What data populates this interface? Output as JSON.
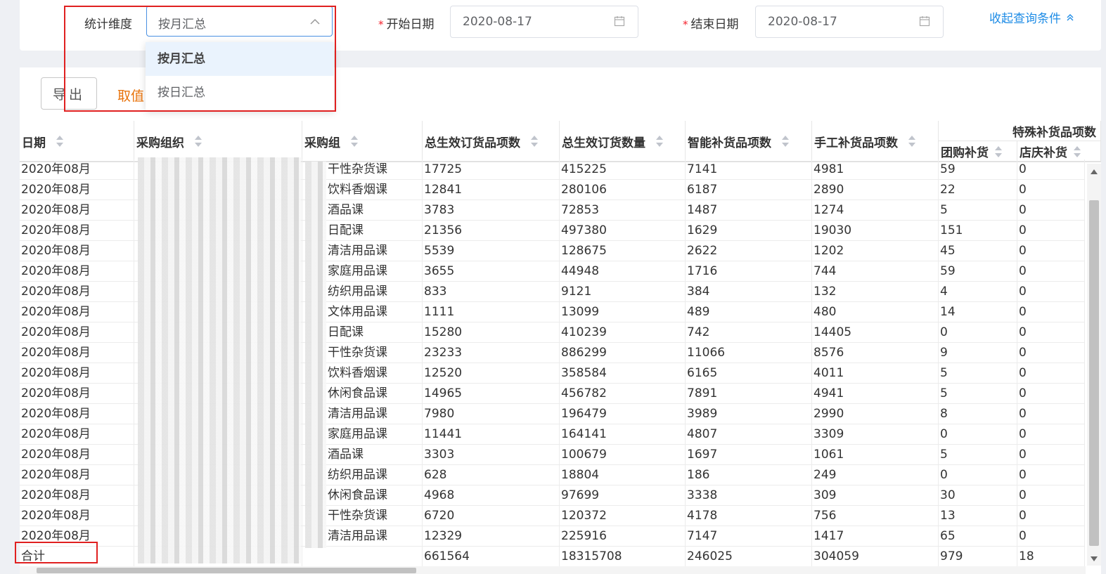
{
  "query": {
    "dimension_label": "统计维度",
    "dimension_value": "按月汇总",
    "start_label": "开始日期",
    "start_value": "2020-08-17",
    "end_label": "结束日期",
    "end_value": "2020-08-17",
    "required_mark": "*",
    "collapse_label": "收起查询条件"
  },
  "dropdown": {
    "options": [
      "按月汇总",
      "按日汇总"
    ],
    "selected": "按月汇总"
  },
  "toolbar": {
    "export_label": "导出",
    "value_link": "取值"
  },
  "table": {
    "headers": {
      "date": "日期",
      "org": "采购组织",
      "group": "采购组",
      "total_items": "总生效订货品项数",
      "total_qty": "总生效订货数量",
      "smart_items": "智能补货品项数",
      "manual_items": "手工补货品项数",
      "special": "特殊补货品项数",
      "group_buy": "团购补货",
      "store_event": "店庆补货"
    },
    "rows": [
      {
        "date": "2020年08月",
        "org": "",
        "group": "干性杂货课",
        "total_items": "17725",
        "total_qty": "415225",
        "smart_items": "7141",
        "manual_items": "4981",
        "group_buy": "59",
        "store_event": "0"
      },
      {
        "date": "2020年08月",
        "org": "",
        "group": "饮料香烟课",
        "total_items": "12841",
        "total_qty": "280106",
        "smart_items": "6187",
        "manual_items": "2890",
        "group_buy": "22",
        "store_event": "0"
      },
      {
        "date": "2020年08月",
        "org": "",
        "group": "酒品课",
        "total_items": "3783",
        "total_qty": "72853",
        "smart_items": "1487",
        "manual_items": "1274",
        "group_buy": "5",
        "store_event": "0"
      },
      {
        "date": "2020年08月",
        "org": "",
        "group": "日配课",
        "total_items": "21356",
        "total_qty": "497380",
        "smart_items": "1629",
        "manual_items": "19030",
        "group_buy": "151",
        "store_event": "0"
      },
      {
        "date": "2020年08月",
        "org": "",
        "group": "清洁用品课",
        "total_items": "5539",
        "total_qty": "128675",
        "smart_items": "2622",
        "manual_items": "1202",
        "group_buy": "45",
        "store_event": "0"
      },
      {
        "date": "2020年08月",
        "org": "",
        "group": "家庭用品课",
        "total_items": "3655",
        "total_qty": "44948",
        "smart_items": "1716",
        "manual_items": "744",
        "group_buy": "59",
        "store_event": "0"
      },
      {
        "date": "2020年08月",
        "org": "",
        "group": "纺织用品课",
        "total_items": "833",
        "total_qty": "9121",
        "smart_items": "384",
        "manual_items": "132",
        "group_buy": "4",
        "store_event": "0"
      },
      {
        "date": "2020年08月",
        "org": "",
        "group": "文体用品课",
        "total_items": "1111",
        "total_qty": "13099",
        "smart_items": "489",
        "manual_items": "480",
        "group_buy": "14",
        "store_event": "0"
      },
      {
        "date": "2020年08月",
        "org": "",
        "group": "日配课",
        "total_items": "15280",
        "total_qty": "410239",
        "smart_items": "742",
        "manual_items": "14405",
        "group_buy": "0",
        "store_event": "0"
      },
      {
        "date": "2020年08月",
        "org": "",
        "group": "干性杂货课",
        "total_items": "23233",
        "total_qty": "886299",
        "smart_items": "11066",
        "manual_items": "8576",
        "group_buy": "9",
        "store_event": "0"
      },
      {
        "date": "2020年08月",
        "org": "",
        "group": "饮料香烟课",
        "total_items": "12520",
        "total_qty": "358584",
        "smart_items": "6165",
        "manual_items": "4011",
        "group_buy": "5",
        "store_event": "0"
      },
      {
        "date": "2020年08月",
        "org": "",
        "group": "休闲食品课",
        "total_items": "14965",
        "total_qty": "456782",
        "smart_items": "7891",
        "manual_items": "4941",
        "group_buy": "5",
        "store_event": "0"
      },
      {
        "date": "2020年08月",
        "org": "",
        "group": "清洁用品课",
        "total_items": "7980",
        "total_qty": "196479",
        "smart_items": "3989",
        "manual_items": "2990",
        "group_buy": "8",
        "store_event": "0"
      },
      {
        "date": "2020年08月",
        "org": "",
        "group": "家庭用品课",
        "total_items": "11441",
        "total_qty": "164141",
        "smart_items": "4807",
        "manual_items": "3309",
        "group_buy": "0",
        "store_event": "0"
      },
      {
        "date": "2020年08月",
        "org": "",
        "group": "酒品课",
        "total_items": "3303",
        "total_qty": "100679",
        "smart_items": "1697",
        "manual_items": "1061",
        "group_buy": "5",
        "store_event": "0"
      },
      {
        "date": "2020年08月",
        "org": "",
        "group": "纺织用品课",
        "total_items": "628",
        "total_qty": "18804",
        "smart_items": "186",
        "manual_items": "249",
        "group_buy": "0",
        "store_event": "0"
      },
      {
        "date": "2020年08月",
        "org": "",
        "group": "休闲食品课",
        "total_items": "4968",
        "total_qty": "97699",
        "smart_items": "3338",
        "manual_items": "309",
        "group_buy": "30",
        "store_event": "0"
      },
      {
        "date": "2020年08月",
        "org": "",
        "group": "干性杂货课",
        "total_items": "6720",
        "total_qty": "120372",
        "smart_items": "4178",
        "manual_items": "756",
        "group_buy": "13",
        "store_event": "0"
      },
      {
        "date": "2020年08月",
        "org": "",
        "group": "清洁用品课",
        "total_items": "12329",
        "total_qty": "225916",
        "smart_items": "7147",
        "manual_items": "1417",
        "group_buy": "65",
        "store_event": "0"
      }
    ],
    "total": {
      "label": "合计",
      "total_items": "661564",
      "total_qty": "18315708",
      "smart_items": "246025",
      "manual_items": "304059",
      "group_buy": "979",
      "store_event": "18"
    }
  },
  "colors": {
    "accent_blue": "#1e8ce6",
    "link_orange": "#e8730c",
    "annotation_red": "#e02020"
  }
}
